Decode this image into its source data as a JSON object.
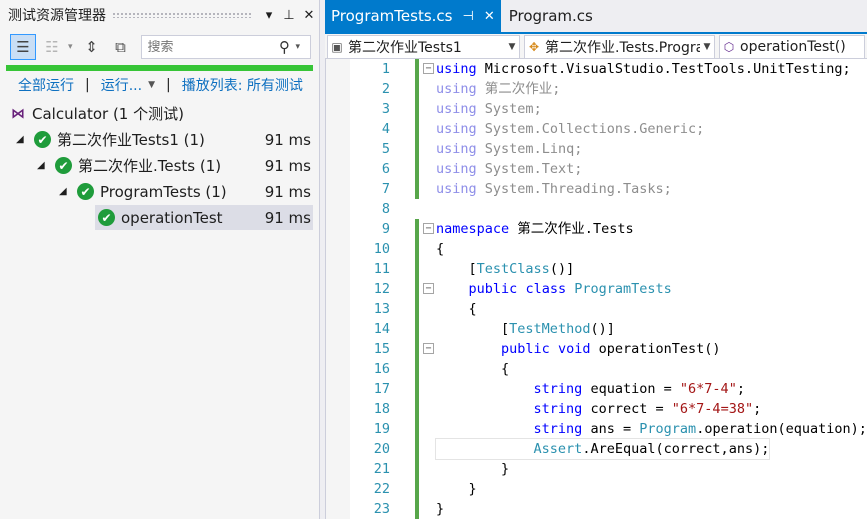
{
  "explorer": {
    "title": "测试资源管理器",
    "search_placeholder": "搜索",
    "links": {
      "run_all": "全部运行",
      "run": "运行...",
      "playlist": "播放列表: 所有测试"
    },
    "project": "Calculator (1 个测试)",
    "nodes": [
      {
        "label": "第二次作业Tests1 (1)",
        "duration": "91 ms"
      },
      {
        "label": "第二次作业.Tests (1)",
        "duration": "91 ms"
      },
      {
        "label": "ProgramTests (1)",
        "duration": "91 ms"
      },
      {
        "label": "operationTest",
        "duration": "91 ms"
      }
    ]
  },
  "editor": {
    "tabs": [
      {
        "label": "ProgramTests.cs"
      },
      {
        "label": "Program.cs"
      }
    ],
    "nav": {
      "project": "第二次作业Tests1",
      "class": "第二次作业.Tests.ProgramTests",
      "member": "operationTest()"
    },
    "lines": [
      "using Microsoft.VisualStudio.TestTools.UnitTesting;",
      "using 第二次作业;",
      "using System;",
      "using System.Collections.Generic;",
      "using System.Linq;",
      "using System.Text;",
      "using System.Threading.Tasks;",
      "",
      "namespace 第二次作业.Tests",
      "{",
      "    [TestClass()]",
      "    public class ProgramTests",
      "    {",
      "        [TestMethod()]",
      "        public void operationTest()",
      "        {",
      "            string equation = \"6*7-4\";",
      "            string correct = \"6*7-4=38\";",
      "            string ans = Program.operation(equation);",
      "            Assert.AreEqual(correct,ans);",
      "        }",
      "    }",
      "}"
    ],
    "line_numbers": [
      "1",
      "2",
      "3",
      "4",
      "5",
      "6",
      "7",
      "8",
      "9",
      "10",
      "11",
      "12",
      "13",
      "14",
      "15",
      "16",
      "17",
      "18",
      "19",
      "20",
      "21",
      "22",
      "23"
    ]
  }
}
